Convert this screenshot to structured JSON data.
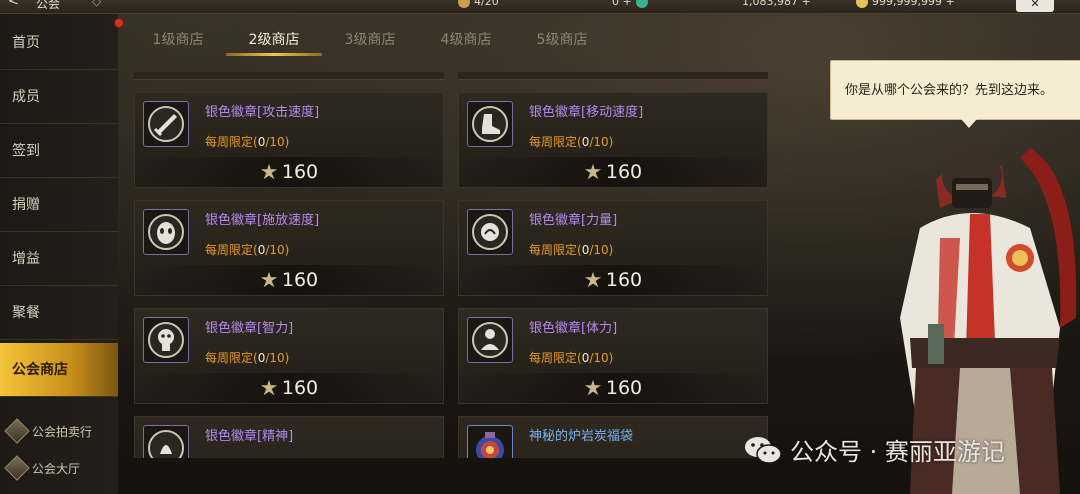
{
  "header": {
    "back_glyph": "<",
    "title": "公会",
    "resources": [
      {
        "value": "4/20",
        "icon": "stamina-icon",
        "color": "#caa14a"
      },
      {
        "value": "0 +",
        "icon": "gem-icon",
        "color": "#37b58e"
      },
      {
        "value": "1,083,987 +",
        "icon": "gold-icon",
        "color": "#d7a42a"
      },
      {
        "value": "999,999,999 +",
        "icon": "coin-icon",
        "color": "#e3c25c"
      }
    ]
  },
  "sidebar": {
    "items": [
      {
        "label": "首页"
      },
      {
        "label": "成员"
      },
      {
        "label": "签到"
      },
      {
        "label": "捐赠"
      },
      {
        "label": "增益"
      },
      {
        "label": "聚餐"
      },
      {
        "label": "公会商店",
        "active": true
      }
    ],
    "sub_items": [
      {
        "label": "公会拍卖行",
        "icon": "auction-icon"
      },
      {
        "label": "公会大厅",
        "icon": "hall-icon"
      }
    ]
  },
  "tabs": [
    {
      "label": "1级商店"
    },
    {
      "label": "2级商店",
      "active": true
    },
    {
      "label": "3级商店"
    },
    {
      "label": "4级商店"
    },
    {
      "label": "5级商店"
    }
  ],
  "shop": {
    "items": [
      {
        "name": "银色徽章[攻击速度]",
        "limit_prefix": "每周限定(",
        "limit_count": "0",
        "limit_suffix": "/10)",
        "price": "160",
        "icon": "sword-badge-icon"
      },
      {
        "name": "银色徽章[移动速度]",
        "limit_prefix": "每周限定(",
        "limit_count": "0",
        "limit_suffix": "/10)",
        "price": "160",
        "icon": "boot-badge-icon"
      },
      {
        "name": "银色徽章[施放速度]",
        "limit_prefix": "每周限定(",
        "limit_count": "0",
        "limit_suffix": "/10)",
        "price": "160",
        "icon": "mask-badge-icon"
      },
      {
        "name": "银色徽章[力量]",
        "limit_prefix": "每周限定(",
        "limit_count": "0",
        "limit_suffix": "/10)",
        "price": "160",
        "icon": "strength-badge-icon"
      },
      {
        "name": "银色徽章[智力]",
        "limit_prefix": "每周限定(",
        "limit_count": "0",
        "limit_suffix": "/10)",
        "price": "160",
        "icon": "intellect-badge-icon"
      },
      {
        "name": "银色徽章[体力]",
        "limit_prefix": "每周限定(",
        "limit_count": "0",
        "limit_suffix": "/10)",
        "price": "160",
        "icon": "vitality-badge-icon"
      },
      {
        "name": "银色徽章[精神]",
        "icon": "spirit-badge-icon"
      },
      {
        "name": "神秘的炉岩炭福袋",
        "icon": "lucky-bag-icon"
      }
    ]
  },
  "npc": {
    "speech": "你是从哪个公会来的？先到这边来。"
  },
  "watermark": {
    "text": "公众号 · 赛丽亚游记"
  }
}
